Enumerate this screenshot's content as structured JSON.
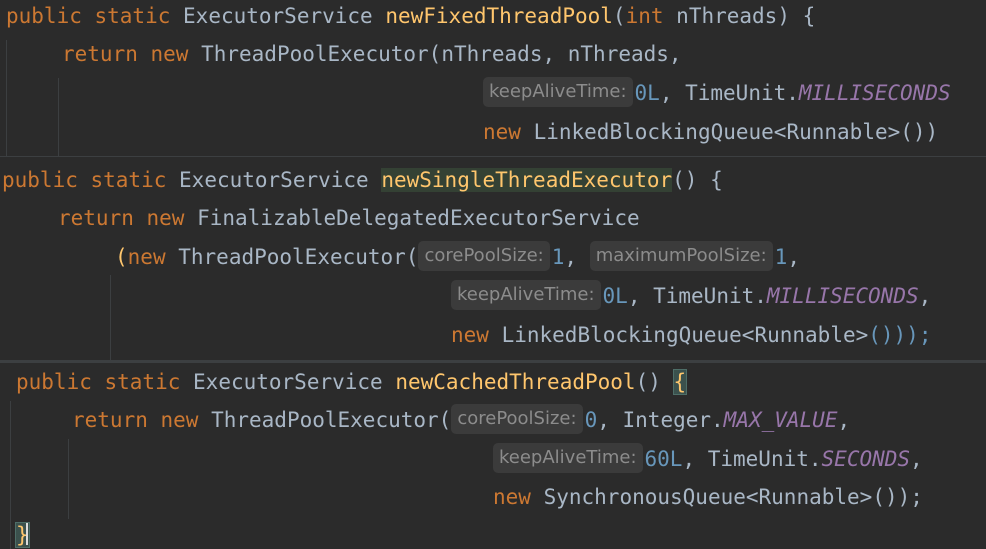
{
  "snippets": [
    {
      "method_name": "newFixedThreadPool",
      "lines": [
        {
          "kw1": "public static",
          "type": "ExecutorService",
          "name": "newFixedThreadPool",
          "open": "(",
          "ptype": "int",
          "pname": "nThreads",
          "close": ") {"
        },
        {
          "kw": "return new",
          "call": "ThreadPoolExecutor",
          "paren": "(",
          "args": "nThreads, nThreads,"
        },
        {
          "hint": "keepAliveTime:",
          "num": "0L",
          "mid": ", TimeUnit.",
          "const": "MILLISECONDS"
        },
        {
          "kw": "new",
          "type": "LinkedBlockingQueue<Runnable>",
          "tail": "())"
        }
      ]
    },
    {
      "method_name": "newSingleThreadExecutor",
      "lines": [
        {
          "kw1": "public static",
          "type": "ExecutorService",
          "name": "newSingleThreadExecutor",
          "tail": "() {"
        },
        {
          "kw": "return new",
          "call": "FinalizableDelegatedExecutorService"
        },
        {
          "open": "(",
          "kw": "new",
          "call": "ThreadPoolExecutor",
          "paren": "(",
          "hint1": "corePoolSize:",
          "num1": "1",
          "sep": ",",
          "hint2": "maximumPoolSize:",
          "num2": "1",
          "end": ","
        },
        {
          "hint": "keepAliveTime:",
          "num": "0L",
          "mid": ", TimeUnit.",
          "const": "MILLISECONDS",
          "end": ","
        },
        {
          "kw": "new",
          "type": "LinkedBlockingQueue<Runnable>",
          "tail": "()));"
        }
      ]
    },
    {
      "method_name": "newCachedThreadPool",
      "lines": [
        {
          "kw1": "public static",
          "type": "ExecutorService",
          "name": "newCachedThreadPool",
          "paren": "()",
          "brace": "{"
        },
        {
          "kw": "return new",
          "call": "ThreadPoolExecutor",
          "paren": "(",
          "hint": "corePoolSize:",
          "num": "0",
          "mid": ", Integer.",
          "const": "MAX_VALUE",
          "end": ","
        },
        {
          "hint": "keepAliveTime:",
          "num": "60L",
          "mid": ", TimeUnit.",
          "const": "SECONDS",
          "end": ","
        },
        {
          "kw": "new",
          "type": "SynchronousQueue<Runnable>",
          "tail": "());"
        },
        {
          "brace": "}"
        }
      ]
    }
  ]
}
